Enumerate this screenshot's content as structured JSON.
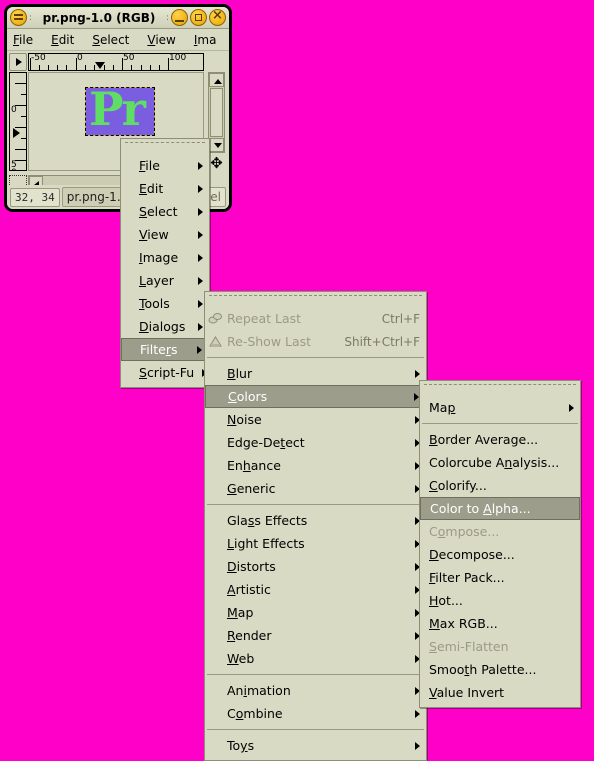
{
  "window": {
    "title": "pr.png-1.0 (RGB)",
    "titlebar_sep": ":",
    "buttons": {
      "menu": "window-menu",
      "minimize": "minimize",
      "maximize": "maximize",
      "close": "close"
    },
    "menubar": [
      {
        "label": "File",
        "mnemonic": "F"
      },
      {
        "label": "Edit",
        "mnemonic": "E"
      },
      {
        "label": "Select",
        "mnemonic": "S"
      },
      {
        "label": "View",
        "mnemonic": "V"
      },
      {
        "label": "Ima",
        "mnemonic": "I"
      }
    ],
    "rulers": {
      "horizontal": [
        "-50",
        "0",
        "50",
        "100"
      ],
      "vertical": [
        "0",
        "5",
        "0"
      ]
    },
    "canvas": {
      "image_text": "Pr",
      "image_bg_color": "#7b5de0",
      "image_fg_color": "#5fdd65"
    },
    "statusbar": {
      "position": "32, 34",
      "title": "pr.png-1.0",
      "unit": "el"
    }
  },
  "desktop": {
    "background_color": "#ff00c8"
  },
  "colors": {
    "menu_bg": "#d9dac4",
    "menu_border": "#8d8e74",
    "highlight": "#9d9d8c",
    "disabled_text": "#9a9a86",
    "accel_text": "#7a7a64"
  },
  "menu1": {
    "name": "image-context-menu",
    "items": [
      {
        "label": "File",
        "mnemonic": "F",
        "submenu": true,
        "selected": false
      },
      {
        "label": "Edit",
        "mnemonic": "E",
        "submenu": true,
        "selected": false
      },
      {
        "label": "Select",
        "mnemonic": "S",
        "submenu": true,
        "selected": false
      },
      {
        "label": "View",
        "mnemonic": "V",
        "submenu": true,
        "selected": false
      },
      {
        "label": "Image",
        "mnemonic": "I",
        "submenu": true,
        "selected": false
      },
      {
        "label": "Layer",
        "mnemonic": "L",
        "submenu": true,
        "selected": false
      },
      {
        "label": "Tools",
        "mnemonic": "T",
        "submenu": true,
        "selected": false
      },
      {
        "label": "Dialogs",
        "mnemonic": "D",
        "submenu": true,
        "selected": false
      },
      {
        "label": "Filters",
        "mnemonic": "r",
        "submenu": true,
        "selected": true
      },
      {
        "label": "Script-Fu",
        "mnemonic": "S",
        "submenu": true,
        "selected": false
      }
    ]
  },
  "menu2": {
    "name": "filters-menu",
    "items": [
      {
        "label": "Repeat Last",
        "accel": "Ctrl+F",
        "disabled": true,
        "icon": "repeat-icon"
      },
      {
        "label": "Re-Show Last",
        "accel": "Shift+Ctrl+F",
        "disabled": true,
        "icon": "reshow-icon"
      },
      {
        "separator": true
      },
      {
        "label": "Blur",
        "mnemonic": "B",
        "submenu": true
      },
      {
        "label": "Colors",
        "mnemonic": "C",
        "submenu": true,
        "selected": true
      },
      {
        "label": "Noise",
        "mnemonic": "N",
        "submenu": true
      },
      {
        "label": "Edge-Detect",
        "mnemonic": "t",
        "submenu": true
      },
      {
        "label": "Enhance",
        "mnemonic": "h",
        "submenu": true
      },
      {
        "label": "Generic",
        "mnemonic": "G",
        "submenu": true
      },
      {
        "separator": true
      },
      {
        "label": "Glass Effects",
        "mnemonic": "s",
        "submenu": true
      },
      {
        "label": "Light Effects",
        "mnemonic": "L",
        "submenu": true
      },
      {
        "label": "Distorts",
        "mnemonic": "D",
        "submenu": true
      },
      {
        "label": "Artistic",
        "mnemonic": "A",
        "submenu": true
      },
      {
        "label": "Map",
        "mnemonic": "M",
        "submenu": true
      },
      {
        "label": "Render",
        "mnemonic": "R",
        "submenu": true
      },
      {
        "label": "Web",
        "mnemonic": "W",
        "submenu": true
      },
      {
        "separator": true
      },
      {
        "label": "Animation",
        "mnemonic": "i",
        "submenu": true
      },
      {
        "label": "Combine",
        "mnemonic": "o",
        "submenu": true
      },
      {
        "separator": true
      },
      {
        "label": "Toys",
        "mnemonic": "y",
        "submenu": true
      }
    ]
  },
  "menu3": {
    "name": "colors-submenu",
    "items": [
      {
        "label": "Map",
        "mnemonic": "p",
        "submenu": true
      },
      {
        "separator": true
      },
      {
        "label": "Border Average...",
        "mnemonic": "B"
      },
      {
        "label": "Colorcube Analysis...",
        "mnemonic": "n"
      },
      {
        "label": "Colorify...",
        "mnemonic": "C"
      },
      {
        "label": "Color to Alpha...",
        "mnemonic": "A",
        "selected": true
      },
      {
        "label": "Compose...",
        "mnemonic": "o",
        "disabled": true
      },
      {
        "label": "Decompose...",
        "mnemonic": "D"
      },
      {
        "label": "Filter Pack...",
        "mnemonic": "F"
      },
      {
        "label": "Hot...",
        "mnemonic": "H"
      },
      {
        "label": "Max RGB...",
        "mnemonic": "M"
      },
      {
        "label": "Semi-Flatten",
        "mnemonic": "S",
        "disabled": true
      },
      {
        "label": "Smooth Palette...",
        "mnemonic": "t"
      },
      {
        "label": "Value Invert",
        "mnemonic": "V"
      }
    ]
  }
}
